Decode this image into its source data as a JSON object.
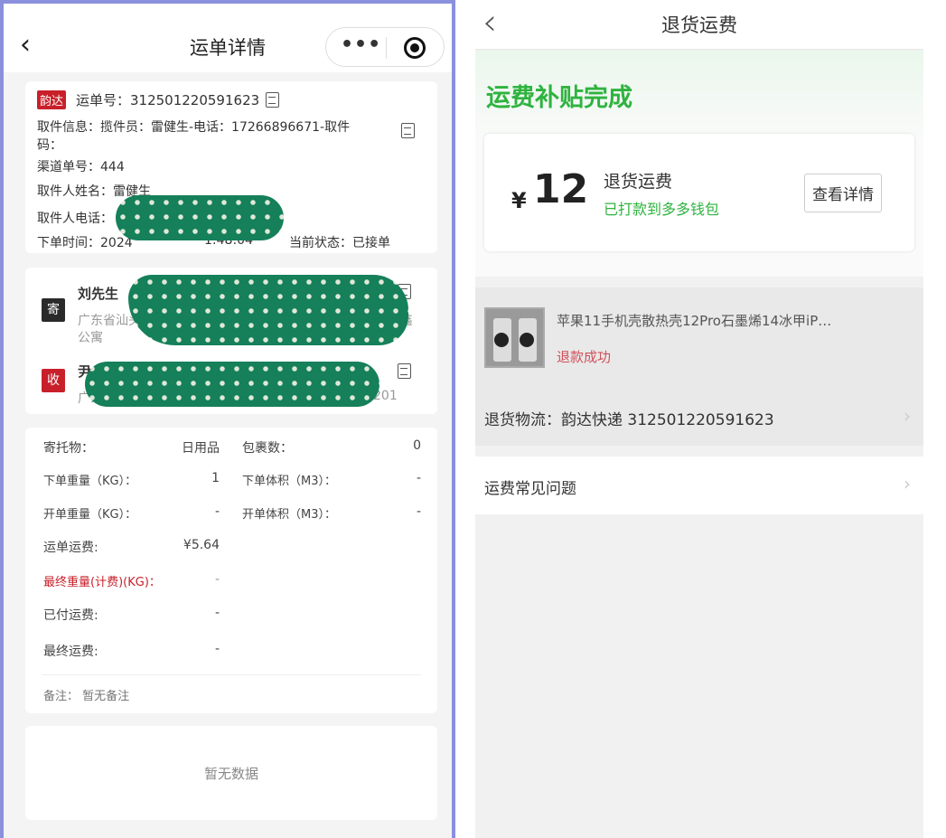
{
  "left": {
    "title": "运单详情",
    "capsule": {
      "more": "•••"
    },
    "waybill": {
      "carrier_badge": "韵达",
      "waybill_no": "运单号：312501220591623",
      "pickup_info_line1": "取件信息：揽件员：雷健生-电话：17266896671-取件",
      "pickup_info_line2": "码：",
      "channel_no": "渠道单号：444",
      "picker_name": "取件人姓名：雷健生",
      "picker_phone_label": "取件人电话：",
      "order_time_prefix": "下单时间：2024",
      "order_time_suffix": "1:48:04",
      "status": "当前状态：已接单"
    },
    "parties": {
      "sender_tag": "寄",
      "sender_name": "刘先生",
      "sender_address": "广东省汕头",
      "sender_address_end": "鑫",
      "sender_address_line2": "公寓",
      "receiver_tag": "收",
      "receiver_name": "尹",
      "receiver_address": "广东省深",
      "receiver_address_end": "201"
    },
    "details": [
      {
        "label": "寄托物：",
        "value": "日用品",
        "label2": "包裹数：",
        "value2": "0"
      },
      {
        "label": "下单重量（KG）：",
        "value": "1",
        "label2": "下单体积（M3）：",
        "value2": "-"
      },
      {
        "label": "开单重量（KG）：",
        "value": "-",
        "label2": "开单体积（M3）：",
        "value2": "-"
      },
      {
        "label": "运单运费:",
        "value": "¥5.64"
      },
      {
        "label": "最终重量(计费)(KG)：",
        "value": "-"
      },
      {
        "label": "已付运费:",
        "value": "-"
      },
      {
        "label": "最终运费:",
        "value": "-"
      }
    ],
    "remark": "备注：  暂无备注",
    "empty": "暂无数据"
  },
  "right": {
    "title": "退货运费",
    "banner_title": "运费补贴完成",
    "currency": "¥",
    "amount": "12",
    "amount_label": "退货运费",
    "amount_status": "已打款到多多钱包",
    "detail_button": "查看详情",
    "product_title": "苹果11手机壳散热壳12Pro石墨烯14冰甲iP…",
    "refund_status": "退款成功",
    "logistics": "退货物流：韵达快递 312501220591623",
    "faq": "运费常见问题"
  },
  "colors": {
    "green": "#2fb33f",
    "red": "#c8202a",
    "frame": "#8a90dc"
  }
}
